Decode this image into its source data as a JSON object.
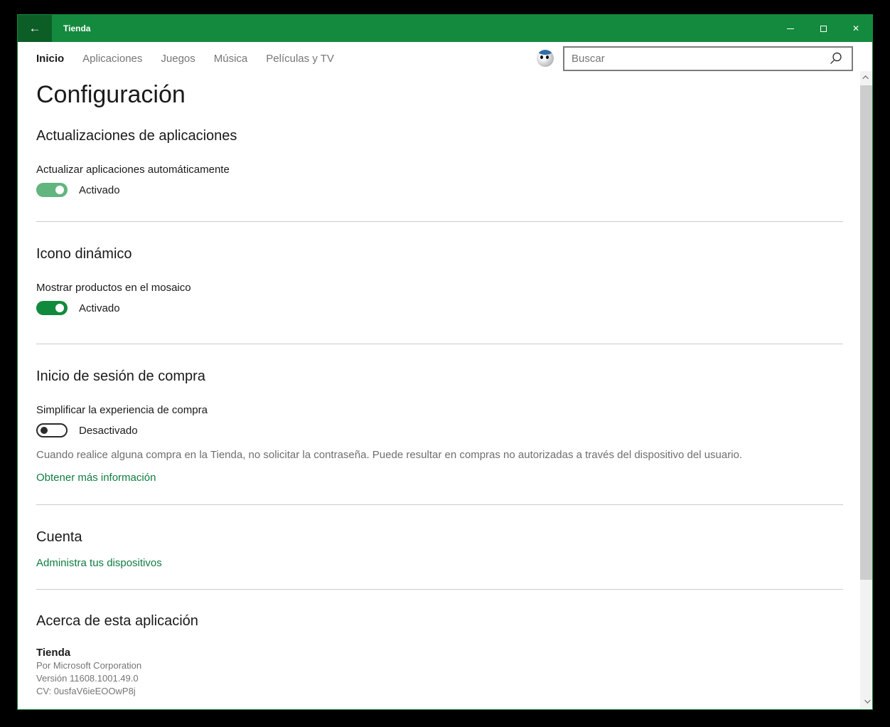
{
  "colors": {
    "titlebar_green": "#148a3e",
    "back_button_green": "#0c5e26",
    "link_green": "#107c41",
    "toggle_on_green": "#118a3e",
    "toggle_on_hover_green": "#62b57e"
  },
  "window": {
    "title": "Tienda"
  },
  "icons": {
    "back_glyph": "←",
    "close_glyph": "✕",
    "minimize": "minimize-bar",
    "maximize": "maximize-square",
    "search": "magnifier",
    "scroll_up": "chevron-up",
    "scroll_down": "chevron-down"
  },
  "nav": {
    "items": [
      {
        "label": "Inicio",
        "active": true
      },
      {
        "label": "Aplicaciones",
        "active": false
      },
      {
        "label": "Juegos",
        "active": false
      },
      {
        "label": "Música",
        "active": false
      },
      {
        "label": "Películas y TV",
        "active": false
      }
    ]
  },
  "search": {
    "placeholder": "Buscar",
    "value": ""
  },
  "page": {
    "title": "Configuración"
  },
  "sections": {
    "app_updates": {
      "title": "Actualizaciones de aplicaciones",
      "toggle_label": "Actualizar aplicaciones automáticamente",
      "toggle_state": "Activado",
      "on": true
    },
    "live_tile": {
      "title": "Icono dinámico",
      "toggle_label": "Mostrar productos en el mosaico",
      "toggle_state": "Activado",
      "on": true
    },
    "purchase_sign_in": {
      "title": "Inicio de sesión de compra",
      "toggle_label": "Simplificar la experiencia de compra",
      "toggle_state": "Desactivado",
      "on": false,
      "description": "Cuando realice alguna compra en la Tienda, no solicitar la contraseña. Puede resultar en compras no autorizadas a través del dispositivo del usuario.",
      "link_label": "Obtener más información"
    },
    "account": {
      "title": "Cuenta",
      "link_label": "Administra tus dispositivos"
    },
    "about": {
      "title": "Acerca de esta aplicación",
      "app_name": "Tienda",
      "publisher": "Por Microsoft Corporation",
      "version": "Versión 11608.1001.49.0",
      "cv": "CV: 0usfaV6ieEOOwP8j"
    }
  }
}
